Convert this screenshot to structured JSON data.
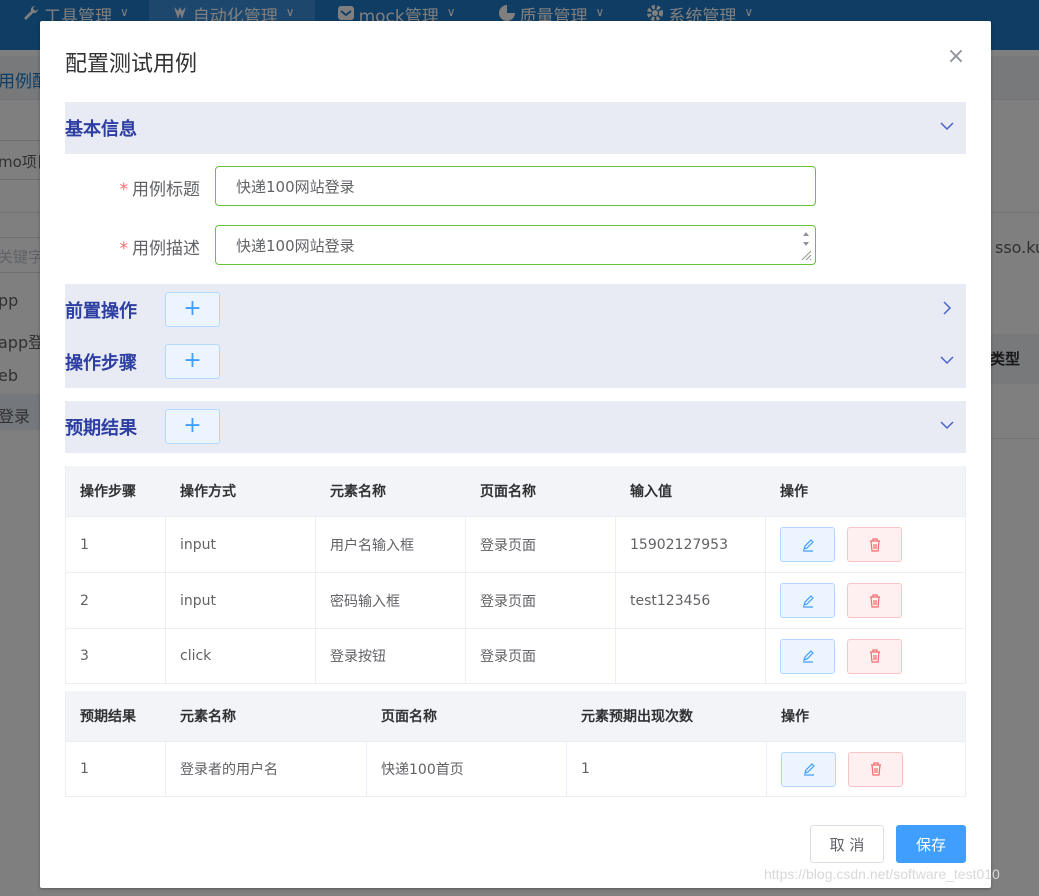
{
  "nav": {
    "items": [
      {
        "label": "工具管理",
        "icon": "wrench-icon"
      },
      {
        "label": "自动化管理",
        "icon": "automation-icon",
        "active": true
      },
      {
        "label": "mock管理",
        "icon": "mock-icon"
      },
      {
        "label": "质量管理",
        "icon": "pie-chart-icon"
      },
      {
        "label": "系统管理",
        "icon": "gear-icon"
      }
    ]
  },
  "background": {
    "breadcrumb_frag": "用例配",
    "select_frag": "mo项目",
    "search_placeholder_frag": "关键字",
    "side_items": [
      "pp",
      "app登",
      "eb",
      "登录"
    ],
    "right_frag": "sso.ku",
    "col_header_frag": "类型"
  },
  "dialog": {
    "title": "配置测试用例",
    "close": "×",
    "sections": {
      "basic": "基本信息",
      "pre": "前置操作",
      "steps": "操作步骤",
      "expected": "预期结果"
    },
    "add_symbol": "+",
    "form": {
      "title_label": "用例标题",
      "title_value": "快递100网站登录",
      "desc_label": "用例描述",
      "desc_value": "快递100网站登录",
      "required_mark": "*"
    },
    "steps_table": {
      "headers": [
        "操作步骤",
        "操作方式",
        "元素名称",
        "页面名称",
        "输入值",
        "操作"
      ],
      "rows": [
        [
          "1",
          "input",
          "用户名输入框",
          "登录页面",
          "15902127953"
        ],
        [
          "2",
          "input",
          "密码输入框",
          "登录页面",
          "test123456"
        ],
        [
          "3",
          "click",
          "登录按钮",
          "登录页面",
          ""
        ]
      ]
    },
    "expected_table": {
      "headers": [
        "预期结果",
        "元素名称",
        "页面名称",
        "元素预期出现次数",
        "操作"
      ],
      "rows": [
        [
          "1",
          "登录者的用户名",
          "快递100首页",
          "1"
        ]
      ]
    },
    "buttons": {
      "cancel": "取 消",
      "save": "保存"
    }
  },
  "watermark": "https://blog.csdn.net/software_test010",
  "colors": {
    "nav": "#1f7bc6",
    "section_title": "#2e3fa3",
    "primary": "#409eff",
    "input_border": "#67c23a",
    "danger": "#f56c6c"
  }
}
